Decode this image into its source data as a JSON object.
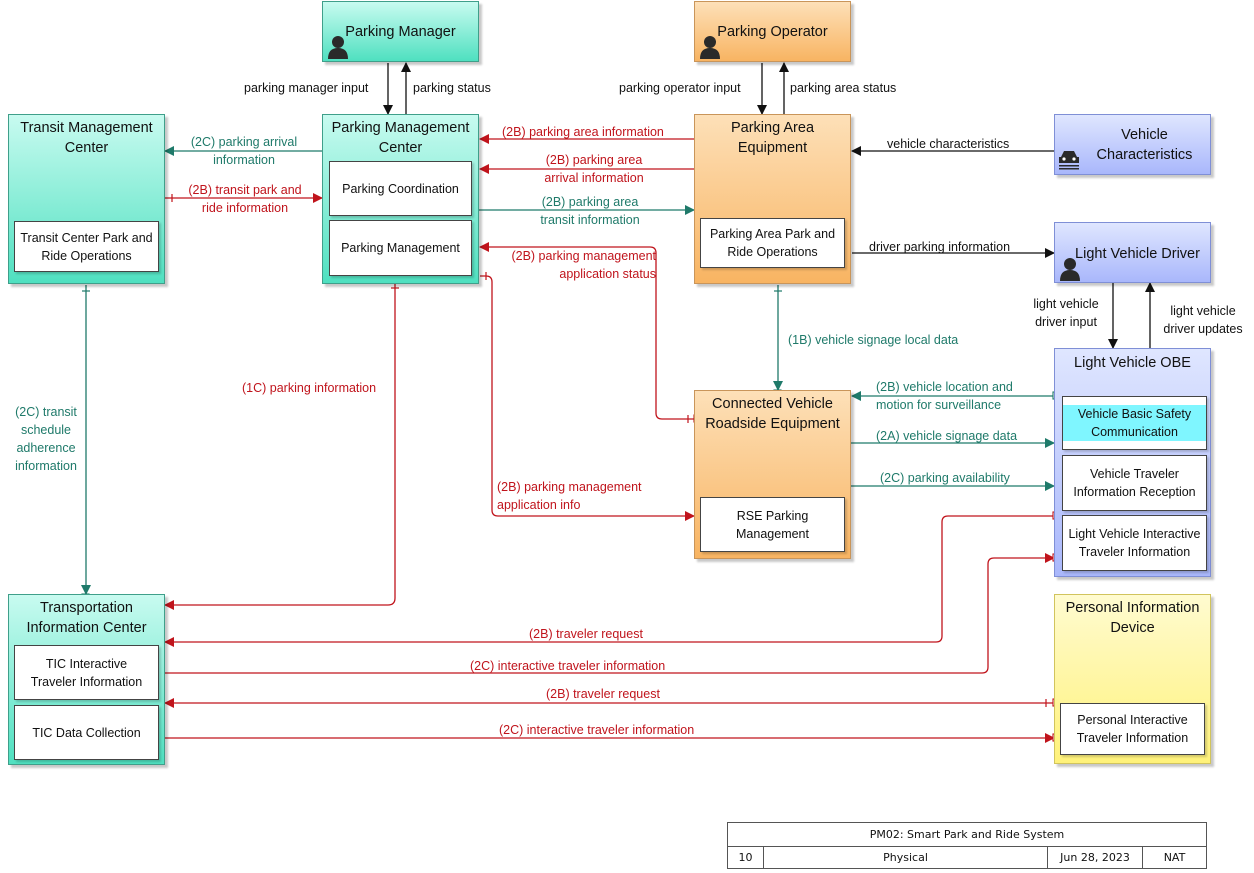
{
  "colors": {
    "green_line": "#1f7a6a",
    "red_line": "#c0141c",
    "black_line": "#111111"
  },
  "nodes": {
    "parking_manager": {
      "title": "Parking Manager",
      "icon": "person-icon"
    },
    "parking_operator": {
      "title": "Parking Operator",
      "icon": "person-icon"
    },
    "transit_mgmt": {
      "title": "Transit Management Center",
      "sub": [
        "Transit Center Park and Ride Operations"
      ]
    },
    "parking_mgmt": {
      "title": "Parking Management Center",
      "sub": [
        "Parking Coordination",
        "Parking Management"
      ]
    },
    "parking_area": {
      "title": "Parking Area Equipment",
      "sub": [
        "Parking Area Park and Ride Operations"
      ]
    },
    "vehicle_char": {
      "title": "Vehicle Characteristics",
      "icon": "car-icon"
    },
    "light_driver": {
      "title": "Light Vehicle Driver",
      "icon": "person-icon"
    },
    "light_obe": {
      "title": "Light Vehicle OBE",
      "sub": [
        "Vehicle Basic Safety Communication",
        "Vehicle Traveler Information Reception",
        "Light Vehicle Interactive Traveler Information"
      ]
    },
    "cv_rse": {
      "title": "Connected Vehicle Roadside Equipment",
      "sub": [
        "RSE Parking Management"
      ]
    },
    "tic": {
      "title": "Transportation Information Center",
      "sub": [
        "TIC Interactive Traveler Information",
        "TIC Data Collection"
      ]
    },
    "pid": {
      "title": "Personal Information Device",
      "sub": [
        "Personal Interactive Traveler Information"
      ]
    }
  },
  "flows": {
    "f01": "parking manager input",
    "f02": "parking status",
    "f03": "parking operator input",
    "f04": "parking area status",
    "f05": "(2B) parking area information",
    "f06": "(2B) parking area arrival information",
    "f07": "(2B) parking area transit information",
    "f08": "(2B) parking management application status",
    "f09": "(2C) parking arrival information",
    "f10": "(2B) transit park and ride information",
    "f11": "vehicle characteristics",
    "f12": "driver parking information",
    "f13": "light vehicle driver input",
    "f14": "light vehicle driver updates",
    "f15": "(1B) vehicle signage local data",
    "f16": "(2B) vehicle location and motion for surveillance",
    "f17": "(2A) vehicle signage data",
    "f18": "(2C) parking availability",
    "f19": "(1C) parking information",
    "f20": "(2C) transit schedule adherence information",
    "f21": "(2B) parking management application info",
    "f22": "(2B) traveler request",
    "f23": "(2C) interactive traveler information",
    "f24": "(2B) traveler request",
    "f25": "(2C) interactive traveler information"
  },
  "footer": {
    "title": "PM02: Smart Park and Ride System",
    "page": "10",
    "view": "Physical",
    "date": "Jun 28, 2023",
    "author": "NAT"
  }
}
